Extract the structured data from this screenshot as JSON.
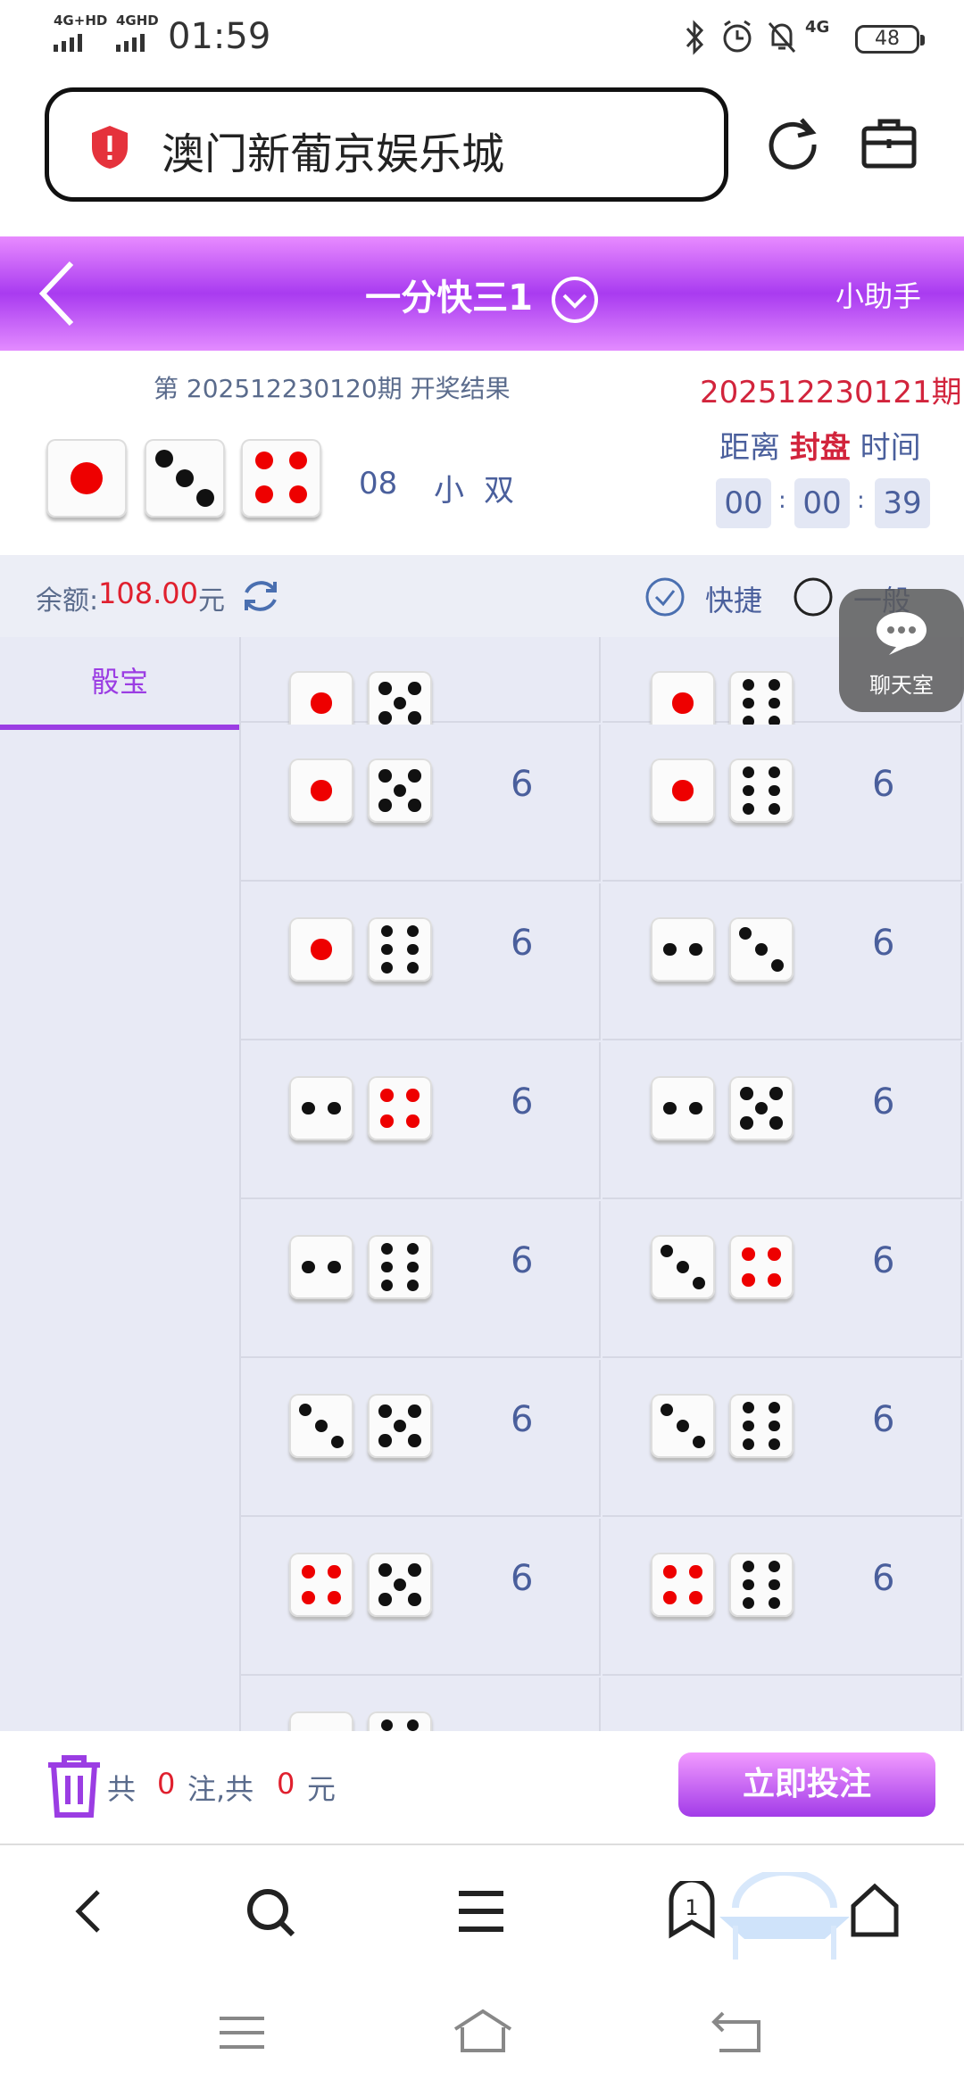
{
  "status": {
    "net1": "4G+HD",
    "net2": "4GHD",
    "time": "01:59",
    "net3": "4G",
    "battery": "48"
  },
  "browser": {
    "title": "澳门新葡京娱乐城"
  },
  "header": {
    "title": "一分快三1",
    "help": "小助手"
  },
  "draw": {
    "last_issue": "第 202512230120期 开奖结果",
    "sum": "08",
    "size": "小",
    "parity": "双",
    "next_issue": "202512230121期",
    "countdown_prefix": "距离",
    "countdown_state": "封盘",
    "countdown_suffix": "时间",
    "hh": "00",
    "mm": "00",
    "ss": "39"
  },
  "balance": {
    "label": "余额:",
    "amount": "108.00",
    "unit": "元",
    "quick": "快捷",
    "normal": "一般"
  },
  "sidebar": {
    "tab": "骰宝"
  },
  "rows": [
    [
      {
        "d": [
          1,
          5
        ],
        "odds": "6"
      },
      {
        "d": [
          1,
          6
        ],
        "odds": "6"
      }
    ],
    [
      {
        "d": [
          1,
          6
        ],
        "odds": "6"
      },
      {
        "d": [
          2,
          3
        ],
        "odds": "6"
      }
    ],
    [
      {
        "d": [
          2,
          4
        ],
        "odds": "6"
      },
      {
        "d": [
          2,
          5
        ],
        "odds": "6"
      }
    ],
    [
      {
        "d": [
          2,
          6
        ],
        "odds": "6"
      },
      {
        "d": [
          3,
          4
        ],
        "odds": "6"
      }
    ],
    [
      {
        "d": [
          3,
          5
        ],
        "odds": "6"
      },
      {
        "d": [
          3,
          6
        ],
        "odds": "6"
      }
    ],
    [
      {
        "d": [
          4,
          5
        ],
        "odds": "6"
      },
      {
        "d": [
          4,
          6
        ],
        "odds": "6"
      }
    ]
  ],
  "bet": {
    "prefix": "共",
    "count": "0",
    "mid": "注,共",
    "amount": "0",
    "unit": "元",
    "button": "立即投注"
  },
  "chat": {
    "label": "聊天室"
  },
  "tabs_badge": "1"
}
